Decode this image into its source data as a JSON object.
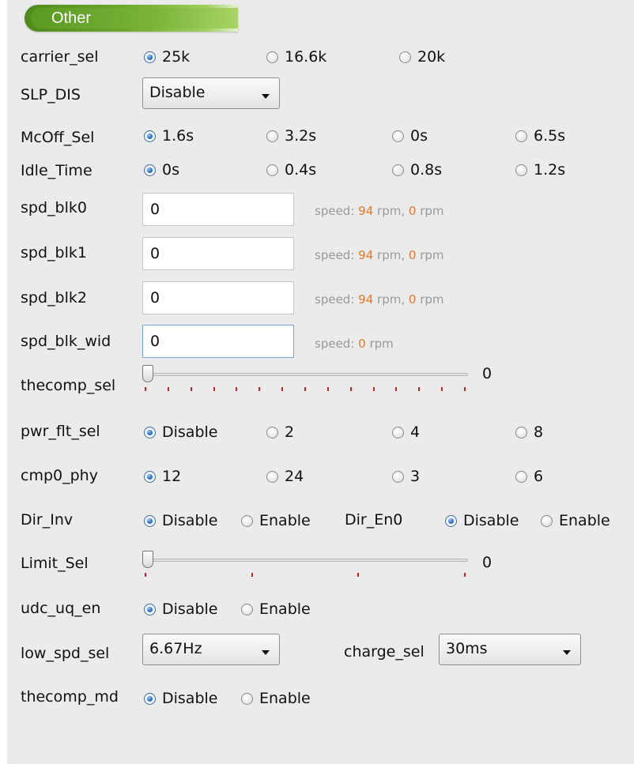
{
  "section_title": "Other",
  "carrier_sel": {
    "label": "carrier_sel",
    "options": [
      "25k",
      "16.6k",
      "20k"
    ],
    "selected": 0
  },
  "slp_dis": {
    "label": "SLP_DIS",
    "value": "Disable"
  },
  "mcoff_sel": {
    "label": "McOff_Sel",
    "options": [
      "1.6s",
      "3.2s",
      "0s",
      "6.5s"
    ],
    "selected": 0
  },
  "idle_time": {
    "label": "Idle_Time",
    "options": [
      "0s",
      "0.4s",
      "0.8s",
      "1.2s"
    ],
    "selected": 0
  },
  "spd_blk0": {
    "label": "spd_blk0",
    "value": "0",
    "speed_prefix": "speed:",
    "speed1": "94",
    "unit1": "rpm,",
    "speed2": "0",
    "unit2": "rpm"
  },
  "spd_blk1": {
    "label": "spd_blk1",
    "value": "0",
    "speed_prefix": "speed:",
    "speed1": "94",
    "unit1": "rpm,",
    "speed2": "0",
    "unit2": "rpm"
  },
  "spd_blk2": {
    "label": "spd_blk2",
    "value": "0",
    "speed_prefix": "speed:",
    "speed1": "94",
    "unit1": "rpm,",
    "speed2": "0",
    "unit2": "rpm"
  },
  "spd_blk_wid": {
    "label": "spd_blk_wid",
    "value": "0",
    "speed_prefix": "speed:",
    "speed1": "0",
    "unit1": "rpm"
  },
  "thecomp_sel": {
    "label": "thecomp_sel",
    "value": "0",
    "slider_position": 0,
    "tick_count": 15
  },
  "pwr_flt_sel": {
    "label": "pwr_flt_sel",
    "options": [
      "Disable",
      "2",
      "4",
      "8"
    ],
    "selected": 0
  },
  "cmp0_phy": {
    "label": "cmp0_phy",
    "options": [
      "12",
      "24",
      "3",
      "6"
    ],
    "selected": 0
  },
  "dir_inv": {
    "label": "Dir_Inv",
    "options": [
      "Disable",
      "Enable"
    ],
    "selected": 0
  },
  "dir_en0": {
    "label": "Dir_En0",
    "options": [
      "Disable",
      "Enable"
    ],
    "selected": 0
  },
  "limit_sel": {
    "label": "Limit_Sel",
    "value": "0",
    "slider_position": 0,
    "tick_count": 4
  },
  "udc_uq_en": {
    "label": "udc_uq_en",
    "options": [
      "Disable",
      "Enable"
    ],
    "selected": 0
  },
  "low_spd_sel": {
    "label": "low_spd_sel",
    "value": "6.67Hz"
  },
  "charge_sel": {
    "label": "charge_sel",
    "value": "30ms"
  },
  "thecomp_md": {
    "label": "thecomp_md",
    "options": [
      "Disable",
      "Enable"
    ],
    "selected": 0
  },
  "colors": {
    "panel_bg": "#ebebeb",
    "tab_green": "#6da52c",
    "speed_value": "#e07a2e",
    "speed_text": "#9a9a9a",
    "tick_red": "#d42020",
    "radio_selected": "#2f6fc8"
  }
}
